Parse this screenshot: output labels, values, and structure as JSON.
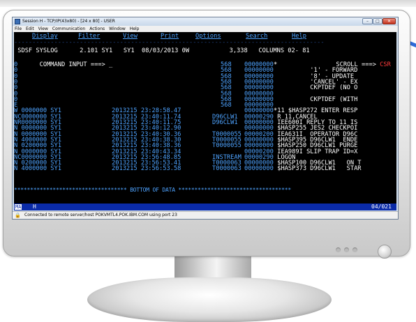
{
  "window": {
    "title": "Session H - TCP/IP(43x80) - [24 x 80] - USER",
    "controls": {
      "minimize": "–",
      "maximize": "□",
      "close": "✕"
    },
    "app_icon": "terminal-emulator-icon"
  },
  "menubar": [
    "File",
    "Edit",
    "View",
    "Communication",
    "Actions",
    "Window",
    "Help"
  ],
  "ispf_menu": [
    "Display",
    "Filter",
    "View",
    "Print",
    "Options",
    "Search",
    "Help"
  ],
  "header": {
    "line1": " SDSF SYSLOG      2.101 SY1   SY1  08/03/2013 0W           3,338   COLUMNS 02- 81",
    "command_label": " COMMAND INPUT ===> ",
    "cursor": "_",
    "scroll_label": "SCROLL ===> ",
    "scroll_value": "CSR"
  },
  "log_rows": [
    {
      "lead": "0",
      "col2": "",
      "col3": "",
      "col4": "568",
      "col5": "00000000",
      "col6": "*",
      "col6_color": "white"
    },
    {
      "lead": "0",
      "col2": "",
      "col3": "",
      "col4": "568",
      "col5": "00000000",
      "col6": "          '1' - FORWARD",
      "col6_color": "white"
    },
    {
      "lead": "0",
      "col2": "",
      "col3": "",
      "col4": "568",
      "col5": "00000000",
      "col6": "          '8' - UPDATE",
      "col6_color": "white"
    },
    {
      "lead": "0",
      "col2": "",
      "col3": "",
      "col4": "568",
      "col5": "00000000",
      "col6": "          'CANCEL' - EX",
      "col6_color": "white"
    },
    {
      "lead": "0",
      "col2": "",
      "col3": "",
      "col4": "568",
      "col5": "00000000",
      "col6": "          CKPTDEF (NO O",
      "col6_color": "white"
    },
    {
      "lead": "0",
      "col2": "",
      "col3": "",
      "col4": "568",
      "col5": "00000000",
      "col6": "",
      "col6_color": "white"
    },
    {
      "lead": "0",
      "col2": "",
      "col3": "",
      "col4": "568",
      "col5": "00000000",
      "col6": "          CKPTDEF (WITH",
      "col6_color": "white"
    },
    {
      "lead": "E",
      "col2": "",
      "col3": "",
      "col4": "568",
      "col5": "00000000",
      "col6": "",
      "col6_color": "white"
    },
    {
      "lead": "W 0000000 SY1",
      "col2": "2013215 23:28:58.47",
      "col3": "",
      "col4": "",
      "col5": "00000000",
      "col6": "*11 $HASP272 ENTER RESP",
      "col6_color": "white"
    },
    {
      "lead": "NC0000000 SY1",
      "col2": "2013215 23:40:11.74",
      "col3": "D96CLW1",
      "col4": "",
      "col5": "00000290",
      "col6": " R 11,CANCEL",
      "col6_color": "white"
    },
    {
      "lead": "NR0000000 SY1",
      "col2": "2013215 23:40:11.75",
      "col3": "D96CLW1",
      "col4": "",
      "col5": "00000000",
      "col6": " IEE600I REPLY TO 11 IS",
      "col6_color": "white"
    },
    {
      "lead": "N 0000000 SY1",
      "col2": "2013215 23:40:12.90",
      "col3": "",
      "col4": "",
      "col5": "00000000",
      "col6": " $HASP255 JES2 CHECKPOI",
      "col6_color": "white"
    },
    {
      "lead": "N 0000000 SY1",
      "col2": "2013215 23:40:30.36",
      "col3": "T0000055",
      "col4": "",
      "col5": "00000200",
      "col6": " IEA631I  OPERATOR D96C",
      "col6_color": "white"
    },
    {
      "lead": "N 4000000 SY1",
      "col2": "2013215 23:40:38.30",
      "col3": "T0000055",
      "col4": "",
      "col5": "00000000",
      "col6": " $HASP395 D96CLW1  ENDE",
      "col6_color": "white"
    },
    {
      "lead": "N 0200000 SY1",
      "col2": "2013215 23:40:38.36",
      "col3": "T0000055",
      "col4": "",
      "col5": "00000000",
      "col6": " $HASP250 D96CLW1 PURGE",
      "col6_color": "white"
    },
    {
      "lead": "N 0000000 SY1",
      "col2": "2013215 23:40:43.34",
      "col3": "",
      "col4": "",
      "col5": "00000200",
      "col6": " IEA989I SLIP TRAP ID=X",
      "col6_color": "white"
    },
    {
      "lead": "NC0000000 SY1",
      "col2": "2013215 23:56:48.85",
      "col3": "INSTREAM",
      "col4": "",
      "col5": "00000290",
      "col6": " LOGON",
      "col6_color": "white"
    },
    {
      "lead": "N 0200000 SY1",
      "col2": "2013215 23:56:53.41",
      "col3": "T0000063",
      "col4": "",
      "col5": "00000000",
      "col6": " $HASP100 D96CLW1   ON T",
      "col6_color": "white"
    },
    {
      "lead": "N 4000000 SY1",
      "col2": "2013215 23:56:53.58",
      "col3": "T0000063",
      "col4": "",
      "col5": "00000000",
      "col6": " $HASP373 D96CLW1   STAR",
      "col6_color": "white"
    }
  ],
  "bottom_marker": "*********************************** BOTTOM OF DATA ***********************************",
  "oia": {
    "mode": "MA",
    "session": "H",
    "position": "04/021"
  },
  "status_bar": {
    "icon": "lock-icon",
    "text": "Connected to remote server/host POKVMTL4.POK.IBM.COM using port 23"
  },
  "colors": {
    "terminal_bg": "#000000",
    "ispf_blue": "#4ea3ff",
    "data_green": "#3fd24a",
    "oia_blue": "#0a2ba8",
    "arrow_blue": "#2f6bd8",
    "scroll_red": "#ff3b3b"
  }
}
